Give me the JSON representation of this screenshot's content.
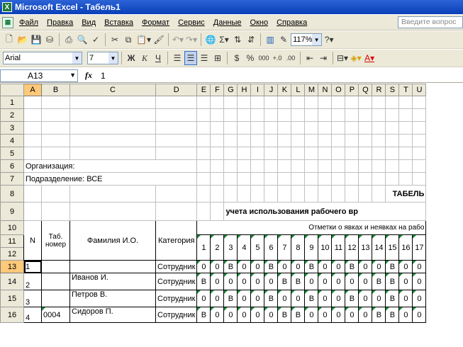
{
  "title": "Microsoft Excel - Табель1",
  "menu": [
    "Файл",
    "Правка",
    "Вид",
    "Вставка",
    "Формат",
    "Сервис",
    "Данные",
    "Окно",
    "Справка"
  ],
  "ask_placeholder": "Введите вопрос",
  "zoom": "117%",
  "font_name": "Arial",
  "font_size": "7",
  "bold_label": "Ж",
  "italic_label": "К",
  "underline_label": "Ч",
  "namebox": "A13",
  "fx_label": "fx",
  "formula": "1",
  "columns": [
    "A",
    "B",
    "C",
    "D",
    "E",
    "F",
    "G",
    "H",
    "I",
    "J",
    "K",
    "L",
    "M",
    "N",
    "O",
    "P",
    "Q",
    "R",
    "S",
    "T",
    "U"
  ],
  "rows": {
    "org": "Организация:",
    "dept": "Подразделение: ВСЕ",
    "heading": "ТАБЕЛЬ",
    "subheading": "учета использования рабочего вр",
    "h_n": "N",
    "h_tab": "Таб. номер",
    "h_fio": "Фамилия И.О.",
    "h_cat": "Категория",
    "h_marks": "Отметки о явках и неявках на рабо",
    "days": [
      "1",
      "2",
      "3",
      "4",
      "5",
      "6",
      "7",
      "8",
      "9",
      "10",
      "11",
      "12",
      "13",
      "14",
      "15",
      "16",
      "17"
    ]
  },
  "employees": [
    {
      "n": "1",
      "tab": "",
      "fio": "",
      "cat": "Сотрудник",
      "d": [
        "0",
        "0",
        "В",
        "0",
        "0",
        "В",
        "0",
        "0",
        "В",
        "0",
        "0",
        "В",
        "0",
        "0",
        "В",
        "0",
        "0"
      ]
    },
    {
      "n": "2",
      "tab": "",
      "fio": "Иванов И.",
      "cat": "Сотрудник",
      "d": [
        "В",
        "0",
        "0",
        "0",
        "0",
        "0",
        "В",
        "В",
        "0",
        "0",
        "0",
        "0",
        "0",
        "В",
        "В",
        "0",
        "0"
      ]
    },
    {
      "n": "3",
      "tab": "",
      "fio": "Петров В.",
      "cat": "Сотрудник",
      "d": [
        "0",
        "0",
        "В",
        "0",
        "0",
        "В",
        "0",
        "0",
        "В",
        "0",
        "0",
        "В",
        "0",
        "0",
        "В",
        "0",
        "0"
      ]
    },
    {
      "n": "4",
      "tab": "0004",
      "fio": "Сидоров П.",
      "cat": "Сотрудник",
      "d": [
        "В",
        "0",
        "0",
        "0",
        "0",
        "0",
        "В",
        "В",
        "0",
        "0",
        "0",
        "0",
        "0",
        "В",
        "В",
        "0",
        "0"
      ]
    }
  ]
}
